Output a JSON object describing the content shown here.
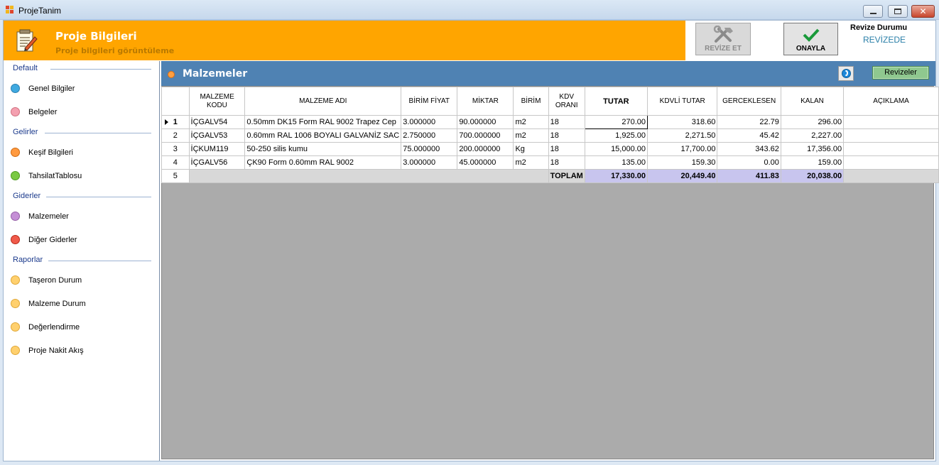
{
  "window": {
    "title": "ProjeTanim"
  },
  "header": {
    "title": "Proje Bilgileri",
    "subtitle": "Proje bilgileri görüntüleme",
    "revize_button": "REVİZE ET",
    "onayla_button": "ONAYLA",
    "revize_durumu_label": "Revize Durumu",
    "revize_durumu_value": "REVİZEDE"
  },
  "sidebar": {
    "groups": [
      {
        "title": "Default",
        "items": [
          {
            "label": "Genel Bilgiler",
            "color": "#3fa9e0"
          },
          {
            "label": "Belgeler",
            "color": "#f4a0b0"
          }
        ]
      },
      {
        "title": "Gelirler",
        "items": [
          {
            "label": "Keşif Bilgileri",
            "color": "#ff9a40"
          },
          {
            "label": "TahsilatTablosu",
            "color": "#7ac943"
          }
        ]
      },
      {
        "title": "Giderler",
        "items": [
          {
            "label": "Malzemeler",
            "color": "#c58fd6"
          },
          {
            "label": "Diğer Giderler",
            "color": "#f05a4a"
          }
        ]
      },
      {
        "title": "Raporlar",
        "items": [
          {
            "label": "Taşeron Durum",
            "color": "#ffd06e"
          },
          {
            "label": "Malzeme Durum",
            "color": "#ffd06e"
          },
          {
            "label": "Değerlendirme",
            "color": "#ffd06e"
          },
          {
            "label": "Proje Nakit Akış",
            "color": "#ffd06e"
          }
        ]
      }
    ]
  },
  "panel": {
    "title": "Malzemeler",
    "revizeler_button": "Revizeler"
  },
  "table": {
    "columns": [
      "",
      "MALZEME KODU",
      "MALZEME ADI",
      "BİRİM FİYAT",
      "MİKTAR",
      "BİRİM",
      "KDV ORANI",
      "TUTAR",
      "KDVLİ TUTAR",
      "GERCEKLESEN",
      "KALAN",
      "AÇIKLAMA"
    ],
    "rows": [
      {
        "no": "1",
        "kod": "İÇGALV54",
        "ad": "0.50mm DK15 Form RAL 9002 Trapez Cep",
        "fiyat": "3.000000",
        "miktar": "90.000000",
        "birim": "m2",
        "kdv": "18",
        "tutar": "270.00",
        "kdvli": "318.60",
        "gerc": "22.79",
        "kalan": "296.00",
        "aciklama": ""
      },
      {
        "no": "2",
        "kod": "İÇGALV53",
        "ad": "0.60mm RAL 1006 BOYALI GALVANİZ SAC",
        "fiyat": "2.750000",
        "miktar": "700.000000",
        "birim": "m2",
        "kdv": "18",
        "tutar": "1,925.00",
        "kdvli": "2,271.50",
        "gerc": "45.42",
        "kalan": "2,227.00",
        "aciklama": ""
      },
      {
        "no": "3",
        "kod": "İÇKUM119",
        "ad": "50-250 silis kumu",
        "fiyat": "75.000000",
        "miktar": "200.000000",
        "birim": "Kg",
        "kdv": "18",
        "tutar": "15,000.00",
        "kdvli": "17,700.00",
        "gerc": "343.62",
        "kalan": "17,356.00",
        "aciklama": ""
      },
      {
        "no": "4",
        "kod": "İÇGALV56",
        "ad": "ÇK90 Form 0.60mm RAL 9002",
        "fiyat": "3.000000",
        "miktar": "45.000000",
        "birim": "m2",
        "kdv": "18",
        "tutar": "135.00",
        "kdvli": "159.30",
        "gerc": "0.00",
        "kalan": "159.00",
        "aciklama": ""
      }
    ],
    "total": {
      "no": "5",
      "label": "TOPLAM",
      "tutar": "17,330.00",
      "kdvli": "20,449.40",
      "gerc": "411.83",
      "kalan": "20,038.00"
    }
  }
}
